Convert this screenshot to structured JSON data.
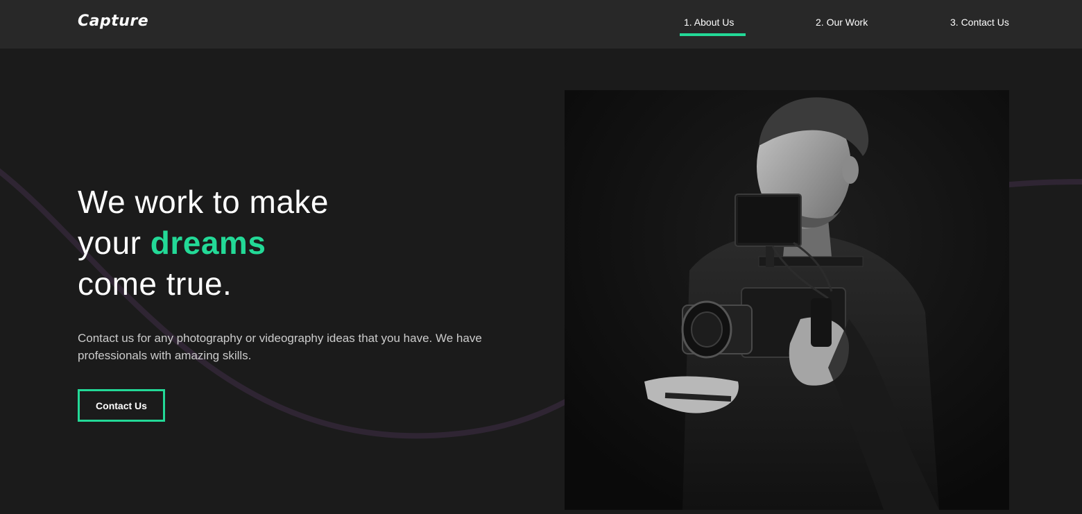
{
  "header": {
    "logo": "Capture",
    "nav": [
      {
        "label": "1. About Us",
        "active": true
      },
      {
        "label": "2. Our Work",
        "active": false
      },
      {
        "label": "3. Contact Us",
        "active": false
      }
    ]
  },
  "hero": {
    "title_line1": "We work to make",
    "title_line2_prefix": "your",
    "title_line2_accent": "dreams",
    "title_line3": "come true.",
    "description": "Contact us for any photography or videography ideas that you have. We have professionals with amazing skills.",
    "cta_label": "Contact Us",
    "image_subject": "photographer-with-camera-icon"
  },
  "colors": {
    "accent": "#23d997",
    "background": "#1b1b1b",
    "navbar": "#282828",
    "curve": "#2f2533"
  }
}
